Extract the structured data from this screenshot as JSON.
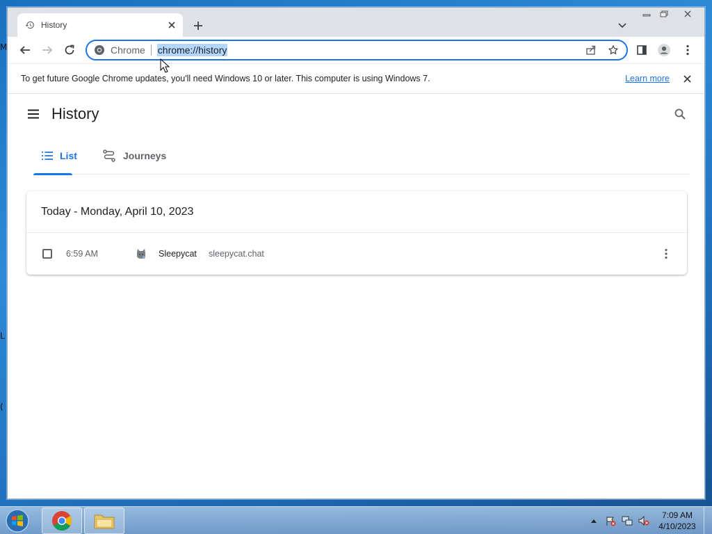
{
  "desktop": {
    "fragments": [
      "M",
      "L",
      "("
    ]
  },
  "window": {
    "tab": {
      "title": "History"
    },
    "toolbar": {
      "omnibox": {
        "chip_label": "Chrome",
        "url": "chrome://history"
      }
    },
    "infobar": {
      "message": "To get future Google Chrome updates, you'll need Windows 10 or later. This computer is using Windows 7.",
      "link": "Learn more"
    }
  },
  "page": {
    "title": "History",
    "tabs": [
      {
        "label": "List",
        "icon": "list-icon",
        "selected": true
      },
      {
        "label": "Journeys",
        "icon": "journeys-icon",
        "selected": false
      }
    ],
    "card": {
      "date_header": "Today - Monday, April 10, 2023",
      "entries": [
        {
          "time": "6:59 AM",
          "title": "Sleepycat",
          "domain": "sleepycat.chat",
          "checked": false
        }
      ]
    }
  },
  "taskbar": {
    "clock": {
      "time": "7:09 AM",
      "date": "4/10/2023"
    }
  },
  "colors": {
    "accent": "#1a73e8",
    "text": "#202124",
    "secondary": "#5f6368"
  }
}
